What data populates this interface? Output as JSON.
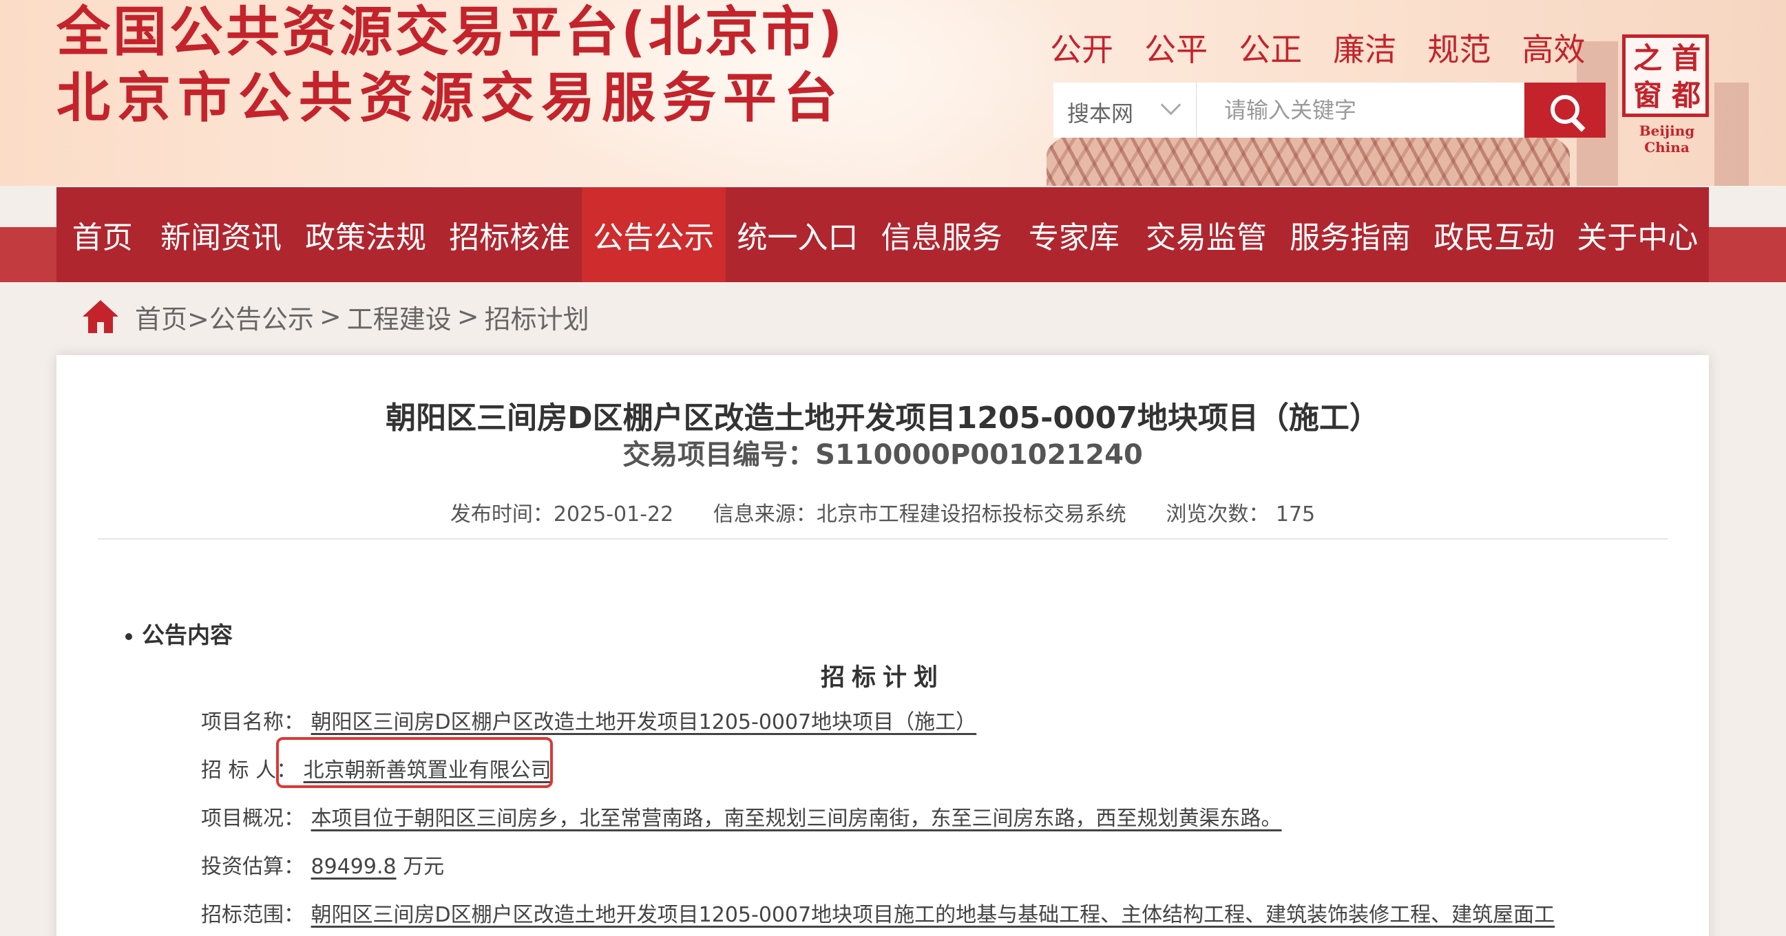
{
  "banner": {
    "title_line1": "全国公共资源交易平台(北京市)",
    "title_line2": "北京市公共资源交易服务平台",
    "slogans": [
      "公开",
      "公平",
      "公正",
      "廉洁",
      "规范",
      "高效"
    ],
    "search": {
      "scope": "搜本网",
      "placeholder": "请输入关键字"
    },
    "seal": {
      "chars": [
        "首",
        "都",
        "之",
        "窗"
      ],
      "caption": "Beijing China"
    },
    "colors": {
      "brand_red": "#c4232b",
      "nav_bg": "#b0262f",
      "nav_active": "#cf2c2e"
    }
  },
  "nav": {
    "items": [
      "首页",
      "新闻资讯",
      "政策法规",
      "招标核准",
      "公告公示",
      "统一入口",
      "信息服务",
      "专家库",
      "交易监管",
      "服务指南",
      "政民互动",
      "关于中心"
    ],
    "active": "公告公示"
  },
  "breadcrumb": {
    "home": "首页>",
    "level1": "公告公示",
    "level2": "工程建设",
    "level3": "招标计划",
    "sep": ">"
  },
  "article": {
    "title": "朝阳区三间房D区棚户区改造土地开发项目1205-0007地块项目（施工）",
    "code": "交易项目编号：S110000P001021240",
    "meta": {
      "publish": "发布时间：2025-01-22",
      "source": "信息来源：北京市工程建设招标投标交易系统",
      "views": "浏览次数： 175"
    },
    "section_heading": "公告内容",
    "doc_title": "招标计划",
    "fields": [
      {
        "label": "项目名称：",
        "value": "朝阳区三间房D区棚户区改造土地开发项目1205-0007地块项目（施工）",
        "suffix": ""
      },
      {
        "label": "招 标 人：",
        "value": "北京朝新善筑置业有限公司",
        "suffix": ""
      },
      {
        "label": "项目概况：",
        "value": "本项目位于朝阳区三间房乡，北至常营南路，南至规划三间房南街，东至三间房东路，西至规划黄渠东路。",
        "suffix": ""
      },
      {
        "label": "投资估算：",
        "value": "89499.8",
        "suffix": "万元"
      },
      {
        "label": "招标范围：",
        "value": "朝阳区三间房D区棚户区改造土地开发项目1205-0007地块项目施工的地基与基础工程、主体结构工程、建筑装饰装修工程、建筑屋面工",
        "suffix": ""
      }
    ]
  }
}
